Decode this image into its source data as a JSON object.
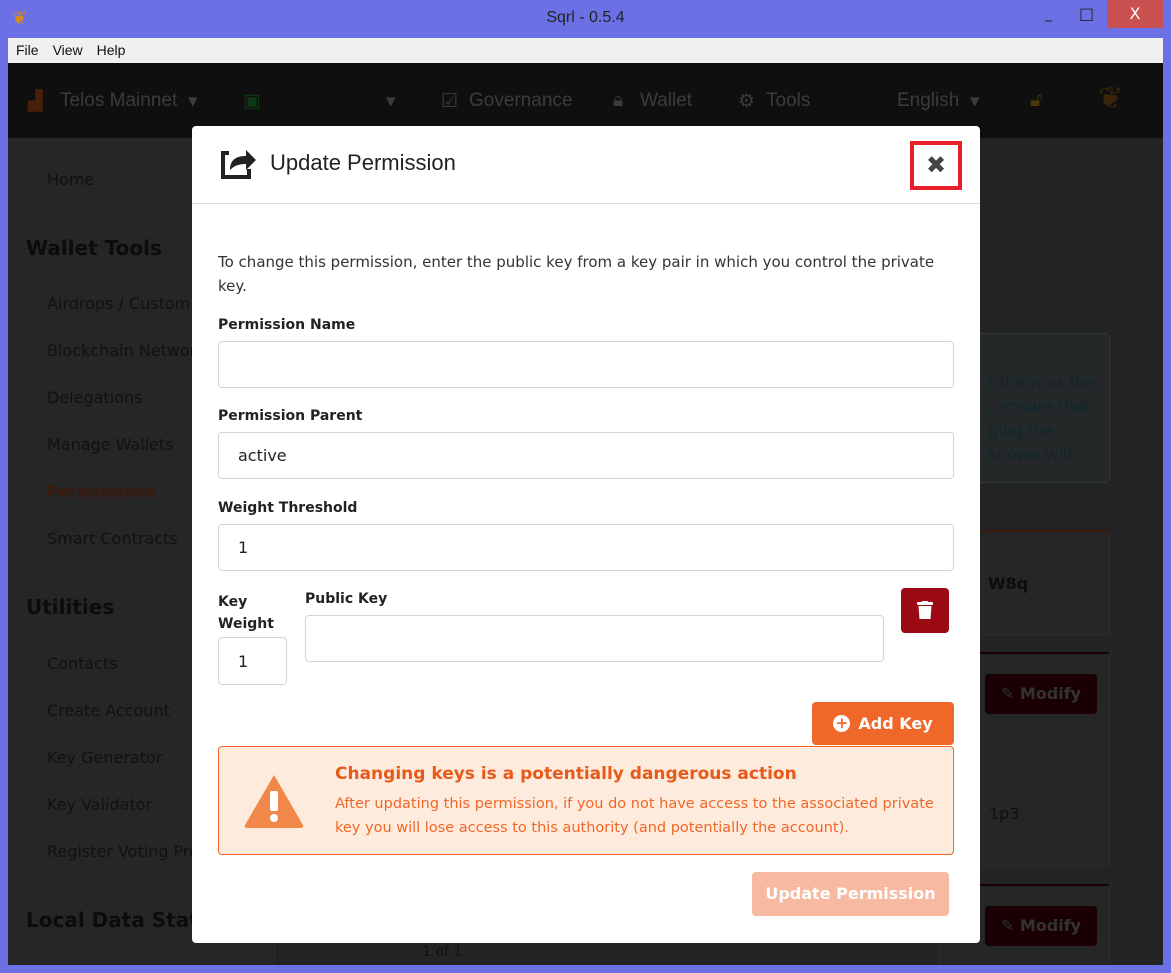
{
  "window": {
    "title": "Sqrl - 0.5.4",
    "minimize": "_",
    "maximize": "□",
    "close": "X"
  },
  "menu": [
    "File",
    "View",
    "Help"
  ],
  "nav": {
    "network": "Telos Mainnet",
    "governance": "Governance",
    "wallet": "Wallet",
    "tools": "Tools",
    "language": "English"
  },
  "sidebar": {
    "home": "Home",
    "sections": [
      {
        "title": "Wallet Tools",
        "items": [
          "Airdrops / Custom Tokens",
          "Blockchain Networks",
          "Delegations",
          "Manage Wallets",
          "Permissions",
          "Smart Contracts"
        ]
      },
      {
        "title": "Utilities",
        "items": [
          "Contacts",
          "Create Account",
          "Key Generator",
          "Key Validator",
          "Register Voting Proxy"
        ]
      },
      {
        "title": "Local Data States"
      }
    ],
    "active_item": "Permissions",
    "active_color": "#f0672a"
  },
  "background": {
    "info_lines": [
      "t them as the",
      ", ensure that",
      "ging the",
      "known will"
    ],
    "key_fragment_1": "W8q",
    "key_fragment_2": "1p3",
    "modify_label": "Modify",
    "pager": "1 of 1"
  },
  "modal": {
    "title": "Update Permission",
    "description": "To change this permission, enter the public key from a key pair in which you control the private key.",
    "fields": {
      "permission_name": {
        "label": "Permission Name",
        "value": ""
      },
      "permission_parent": {
        "label": "Permission Parent",
        "value": "active"
      },
      "weight_threshold": {
        "label": "Weight Threshold",
        "value": "1"
      },
      "key_weight": {
        "label": "Key Weight",
        "value": "1"
      },
      "public_key": {
        "label": "Public Key",
        "value": ""
      }
    },
    "add_key": "Add Key",
    "warning": {
      "title": "Changing keys is a potentially dangerous action",
      "text": "After updating this permission, if you do not have access to the associated private key you will lose access to this authority (and potentially the account)."
    },
    "submit": "Update Permission",
    "colors": {
      "accent": "#f0672a",
      "danger": "#9b0a12",
      "highlight": "#e8202a"
    }
  }
}
